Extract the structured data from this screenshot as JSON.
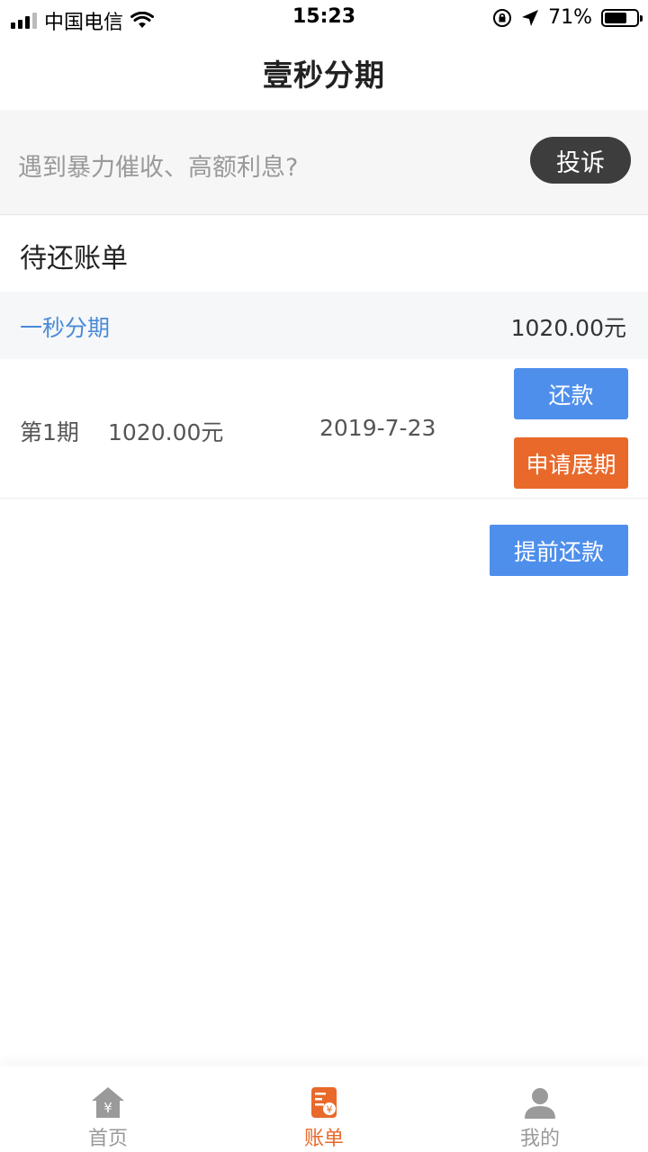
{
  "status_bar": {
    "carrier": "中国电信",
    "time": "15:23",
    "battery_percent": "71%",
    "battery_level": 0.71
  },
  "nav": {
    "title": "壹秒分期"
  },
  "complaint": {
    "text": "遇到暴力催收、高额利息?",
    "button_label": "投诉"
  },
  "bills": {
    "section_title": "待还账单",
    "product_name": "一秒分期",
    "product_amount": "1020.00元",
    "installments": [
      {
        "period": "第1期",
        "amount": "1020.00元",
        "date": "2019-7-23",
        "repay_label": "还款",
        "extend_label": "申请展期"
      }
    ],
    "prepay_label": "提前还款"
  },
  "tab_bar": {
    "items": [
      {
        "label": "首页",
        "icon": "home-icon"
      },
      {
        "label": "账单",
        "icon": "bill-icon"
      },
      {
        "label": "我的",
        "icon": "user-icon"
      }
    ],
    "active_index": 1
  },
  "colors": {
    "accent_blue": "#4f8fec",
    "accent_orange": "#e8692a",
    "link_blue": "#4a8ad8",
    "dark_button": "#3d3d3d"
  }
}
